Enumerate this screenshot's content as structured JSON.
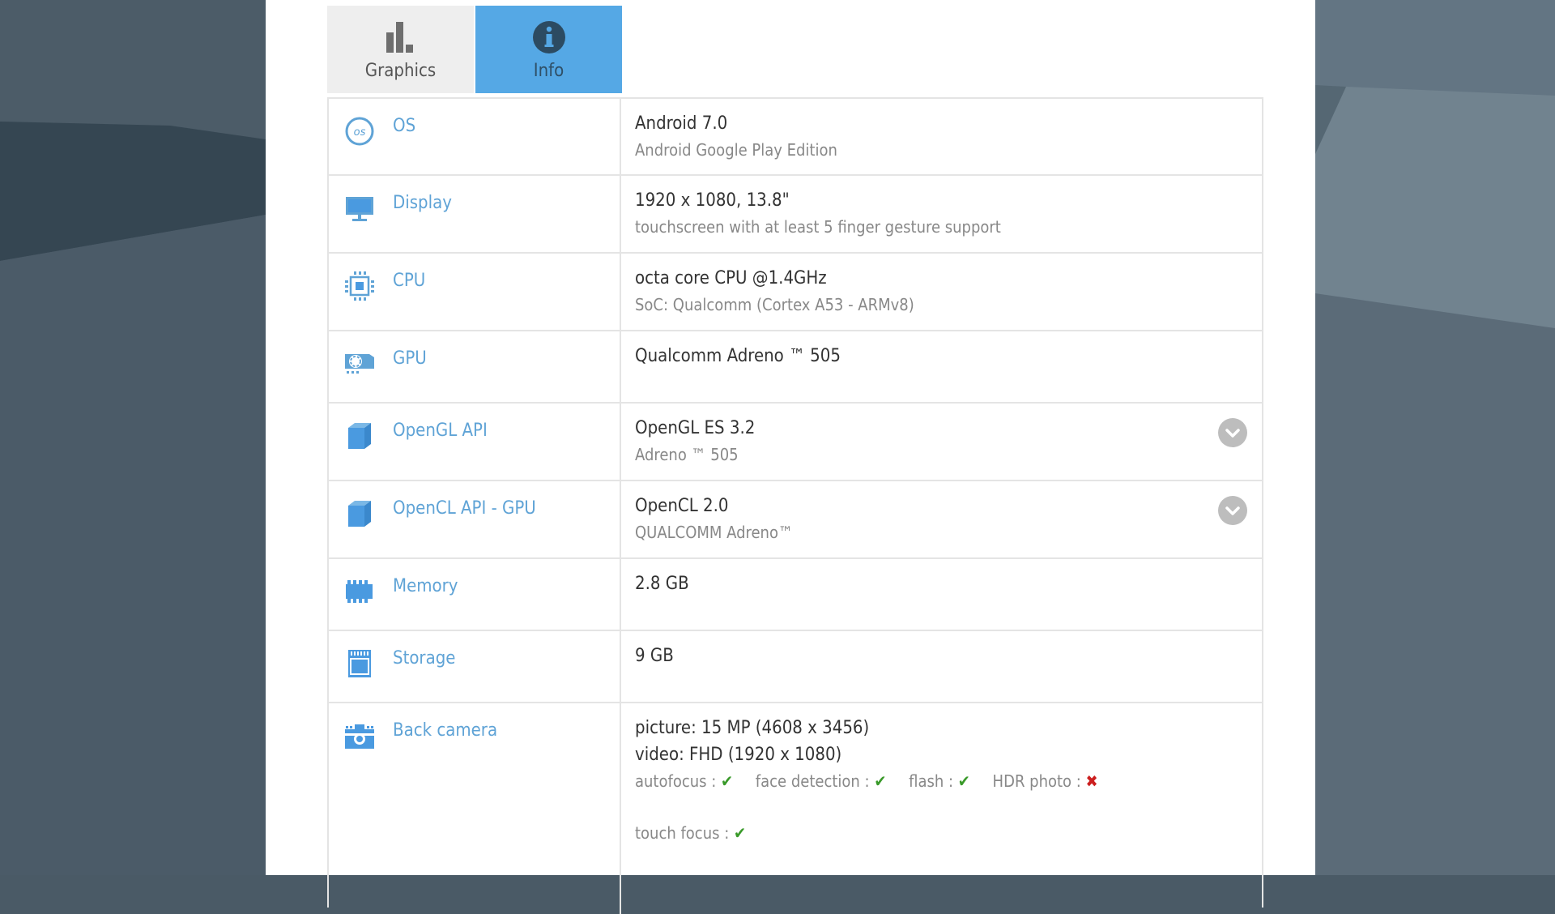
{
  "colors": {
    "accent": "#55a8e5",
    "label_blue": "#5fa3d6",
    "check_green": "#3a9a2a",
    "cross_red": "#cc1f1f"
  },
  "tabs": [
    {
      "label": "Graphics",
      "icon": "bar-chart-icon",
      "active": false
    },
    {
      "label": "Info",
      "icon": "info-icon",
      "active": true
    }
  ],
  "rows": [
    {
      "label": "OS",
      "icon": "os-icon",
      "main": "Android 7.0",
      "sub": "Android Google Play Edition",
      "expandable": false
    },
    {
      "label": "Display",
      "icon": "monitor-icon",
      "main": "1920 x 1080, 13.8\"",
      "sub": "touchscreen with at least 5 finger gesture support",
      "expandable": false
    },
    {
      "label": "CPU",
      "icon": "cpu-icon",
      "main": "octa core CPU @1.4GHz",
      "sub": "SoC: Qualcomm (Cortex A53 - ARMv8)",
      "expandable": false
    },
    {
      "label": "GPU",
      "icon": "gpu-icon",
      "main": "Qualcomm Adreno ™ 505",
      "sub": "",
      "expandable": false
    },
    {
      "label": "OpenGL API",
      "icon": "cube-icon",
      "main": "OpenGL ES 3.2",
      "sub": "Adreno ™ 505",
      "expandable": true
    },
    {
      "label": "OpenCL API - GPU",
      "icon": "cube-icon",
      "main": "OpenCL 2.0",
      "sub": "QUALCOMM Adreno™",
      "expandable": true
    },
    {
      "label": "Memory",
      "icon": "memory-icon",
      "main": "2.8 GB",
      "sub": "",
      "expandable": false
    },
    {
      "label": "Storage",
      "icon": "sd-card-icon",
      "main": "9 GB",
      "sub": "",
      "expandable": false
    },
    {
      "label": "Back camera",
      "icon": "camera-icon",
      "main": "picture: 15 MP (4608 x 3456)",
      "main2": "video: FHD (1920 x 1080)",
      "features": [
        {
          "name": "autofocus :",
          "supported": true
        },
        {
          "name": "face detection :",
          "supported": true
        },
        {
          "name": "flash :",
          "supported": true
        },
        {
          "name": "HDR photo :",
          "supported": false
        }
      ],
      "features2": [
        {
          "name": "touch focus :",
          "supported": true
        }
      ],
      "check_glyph": "✔",
      "cross_glyph": "✖"
    }
  ]
}
